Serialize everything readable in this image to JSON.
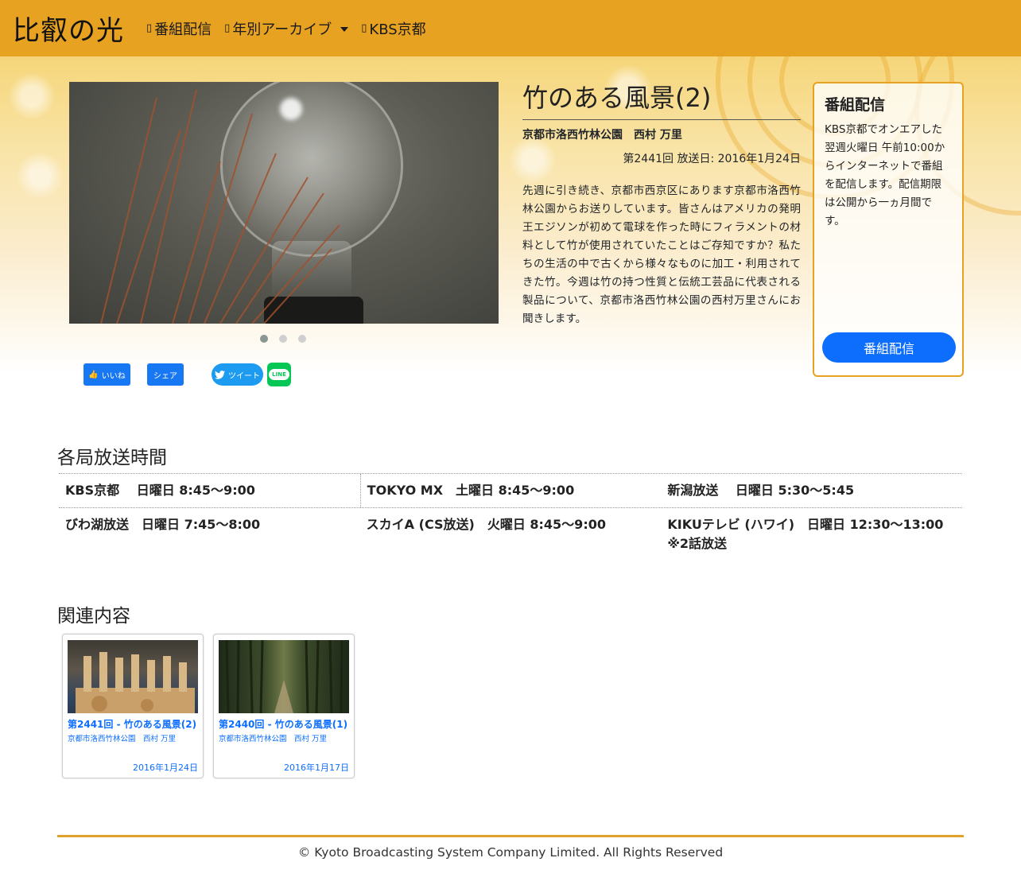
{
  "navbar": {
    "brand": "比叡の光",
    "items": [
      {
        "icon": "tv-icon",
        "label": "番組配信"
      },
      {
        "icon": "archive-icon",
        "label": "年別アーカイブ"
      },
      {
        "icon": "home-icon",
        "label": "KBS京都"
      }
    ]
  },
  "carousel": {
    "slide_count": 3,
    "active_index": 0
  },
  "episode": {
    "title": "竹のある風景(2)",
    "guest": "京都市洛西竹林公園　西村 万里",
    "date": "第2441回 放送日: 2016年1月24日",
    "description": "先週に引き続き、京都市西京区にあります京都市洛西竹林公園からお送りしています。皆さんはアメリカの発明王エジソンが初めて電球を作った時にフィラメントの材料として竹が使用されていたことはご存知ですか？私たちの生活の中で古くから様々なものに加工・利用されてきた竹。今週は竹の持つ性質と伝統工芸品に代表される製品について、京都市洛西竹林公園の西村万里さんにお聞きします。"
  },
  "share": {
    "fb_like": "いいね",
    "fb_share": "シェア",
    "tweet": "ツイート",
    "line": "LINE"
  },
  "sidebox": {
    "title": "番組配信",
    "text": "KBS京都でオンエアした翌週火曜日 午前10:00からインターネットで番組を配信します。配信期限は公開から一ヵ月間です。",
    "button": "番組配信"
  },
  "schedule": {
    "title": "各局放送時間",
    "rows": [
      [
        "KBS京都　 日曜日 8:45〜9:00",
        "TOKYO MX　土曜日 8:45〜9:00",
        "新潟放送　 日曜日 5:30〜5:45"
      ],
      [
        "びわ湖放送　日曜日 7:45〜8:00",
        "スカイA (CS放送)　火曜日 8:45〜9:00",
        "KIKUテレビ (ハワイ)　日曜日 12:30〜13:00 ※2話放送"
      ]
    ]
  },
  "related": {
    "title": "関連内容",
    "cards": [
      {
        "title": "第2441回 - 竹のある風景(2)",
        "sub": "京都市洛西竹林公園　西村 万里",
        "date": "2016年1月24日"
      },
      {
        "title": "第2440回 - 竹のある風景(1)",
        "sub": "京都市洛西竹林公園　西村 万里",
        "date": "2016年1月17日"
      }
    ]
  },
  "footer": {
    "text": "© Kyoto Broadcasting System Company Limited. All Rights Reserved"
  },
  "colors": {
    "navbar": "#e8a222",
    "accent_blue": "#0d6efd",
    "border_gold": "#e8a222"
  }
}
